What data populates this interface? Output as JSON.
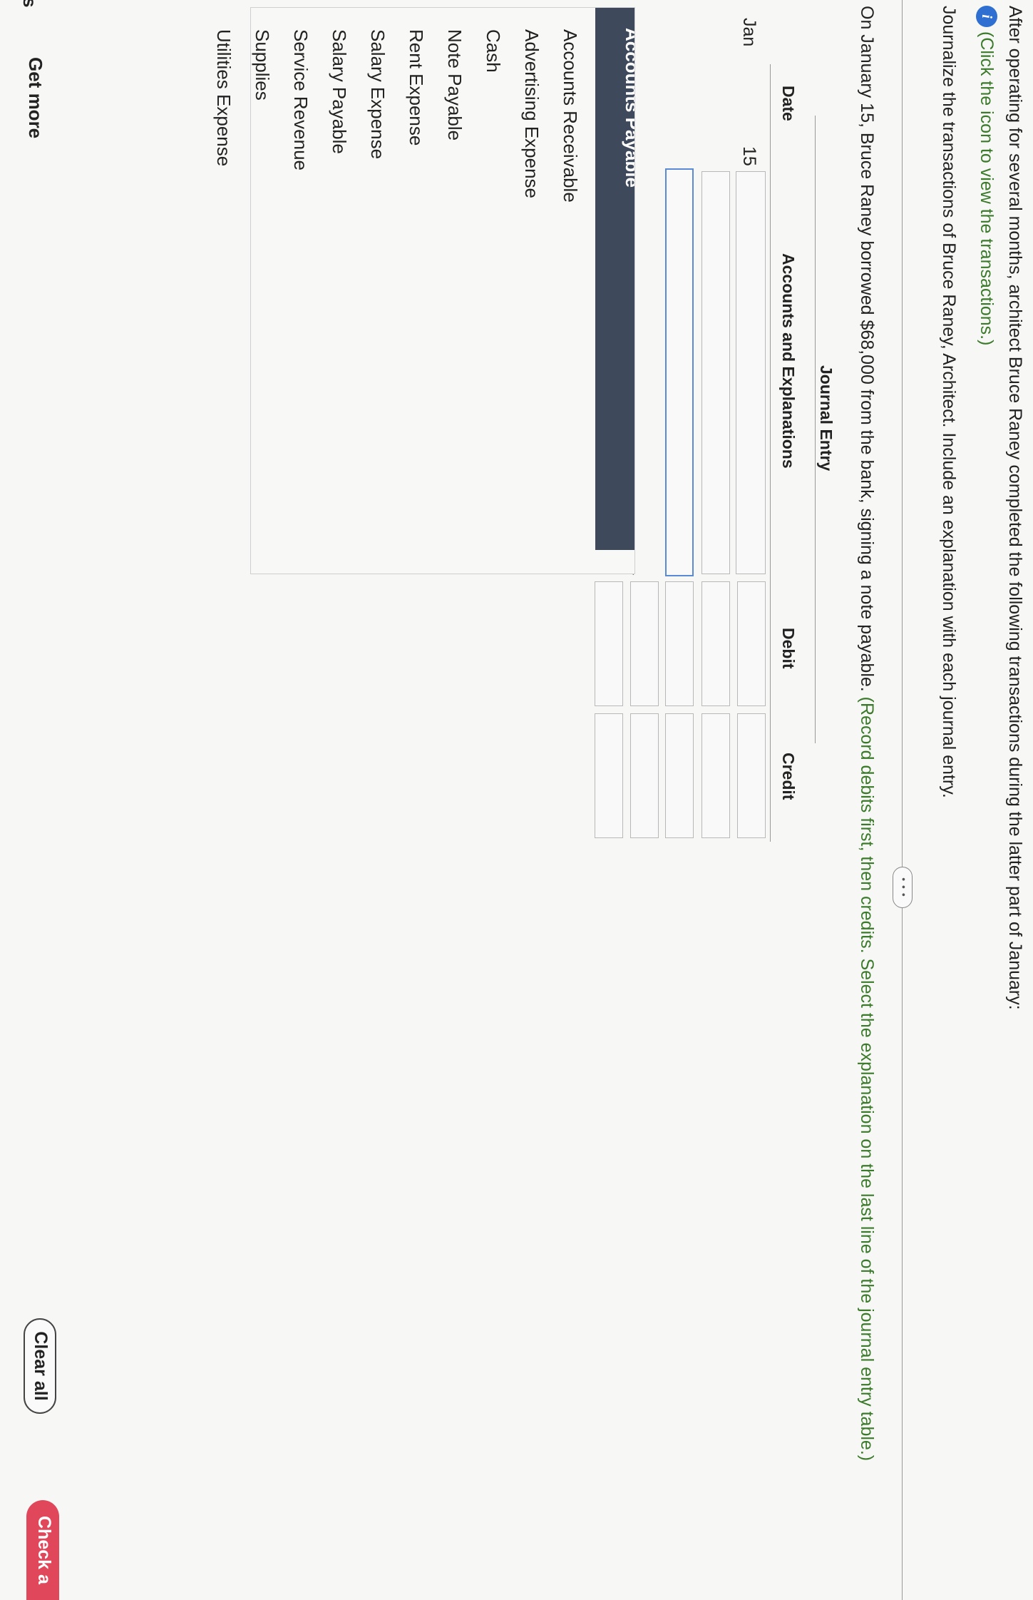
{
  "intro": "After operating for several months, architect Bruce Raney completed the following transactions during the latter part of January:",
  "info_link": "(Click the icon to view the transactions.)",
  "instruction": "Journalize the transactions of Bruce Raney, Architect. Include an explanation with each journal entry.",
  "more_label": "• • •",
  "question": "On January 15, Bruce Raney borrowed $68,000 from the bank, signing a note payable.",
  "question_hint": "(Record debits first, then credits. Select the explanation on the last line of the journal entry table.)",
  "journal": {
    "title": "Journal Entry",
    "headers": {
      "date": "Date",
      "accounts": "Accounts and Explanations",
      "debit": "Debit",
      "credit": "Credit"
    },
    "month": "Jan",
    "day": "15"
  },
  "dropdown": {
    "selected": "Accounts Payable",
    "options": [
      "Accounts Receivable",
      "Advertising Expense",
      "Cash",
      "Note Payable",
      "Rent Expense",
      "Salary Expense",
      "Salary Payable",
      "Service Revenue",
      "Supplies",
      "Utilities Expense"
    ]
  },
  "footer": {
    "side_letter": "s",
    "get_more": "Get more",
    "clear_all": "Clear all",
    "check": "Check a"
  },
  "colors": {
    "accent_green": "#3a7a2a",
    "info_blue": "#2f6fd1",
    "dropdown_dark": "#3e4a5c",
    "check_red": "#e0475b"
  }
}
